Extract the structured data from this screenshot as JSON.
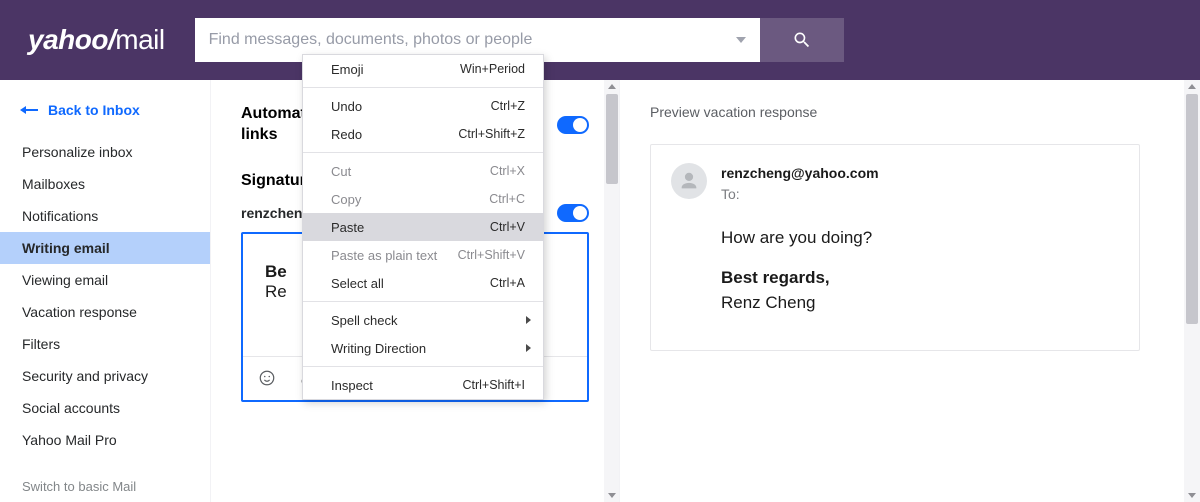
{
  "logo": {
    "brand": "yahoo",
    "bang": "/",
    "product": "mail"
  },
  "search": {
    "placeholder": "Find messages, documents, photos or people"
  },
  "sidebar": {
    "back_label": "Back to Inbox",
    "items": [
      {
        "label": "Personalize inbox"
      },
      {
        "label": "Mailboxes"
      },
      {
        "label": "Notifications"
      },
      {
        "label": "Writing email"
      },
      {
        "label": "Viewing email"
      },
      {
        "label": "Vacation response"
      },
      {
        "label": "Filters"
      },
      {
        "label": "Security and privacy"
      },
      {
        "label": "Social accounts"
      },
      {
        "label": "Yahoo Mail Pro"
      }
    ],
    "active_index": 3,
    "switch_basic": "Switch to basic Mail"
  },
  "settings": {
    "auto_link_label": "Automat\nlinks",
    "auto_link_on": true,
    "signature_heading": "Signatur",
    "signature_account": "renzcheng",
    "signature_on": true,
    "signature_body": {
      "line1_bold": "Be",
      "line2": "Re"
    }
  },
  "context_menu": {
    "items": [
      {
        "label": "Emoji",
        "shortcut": "Win+Period",
        "sep_after": true
      },
      {
        "label": "Undo",
        "shortcut": "Ctrl+Z"
      },
      {
        "label": "Redo",
        "shortcut": "Ctrl+Shift+Z",
        "sep_after": true
      },
      {
        "label": "Cut",
        "shortcut": "Ctrl+X",
        "disabled": true
      },
      {
        "label": "Copy",
        "shortcut": "Ctrl+C",
        "disabled": true
      },
      {
        "label": "Paste",
        "shortcut": "Ctrl+V",
        "selected": true
      },
      {
        "label": "Paste as plain text",
        "shortcut": "Ctrl+Shift+V",
        "disabled": true
      },
      {
        "label": "Select all",
        "shortcut": "Ctrl+A",
        "sep_after": true
      },
      {
        "label": "Spell check",
        "submenu": true
      },
      {
        "label": "Writing Direction",
        "submenu": true,
        "sep_after": true
      },
      {
        "label": "Inspect",
        "shortcut": "Ctrl+Shift+I"
      }
    ]
  },
  "preview": {
    "title": "Preview vacation response",
    "from_email": "renzcheng@yahoo.com",
    "to_label": "To:",
    "body": {
      "greeting": "How are you doing?",
      "signoff_bold": "Best regards,",
      "name": "Renz Cheng"
    }
  }
}
